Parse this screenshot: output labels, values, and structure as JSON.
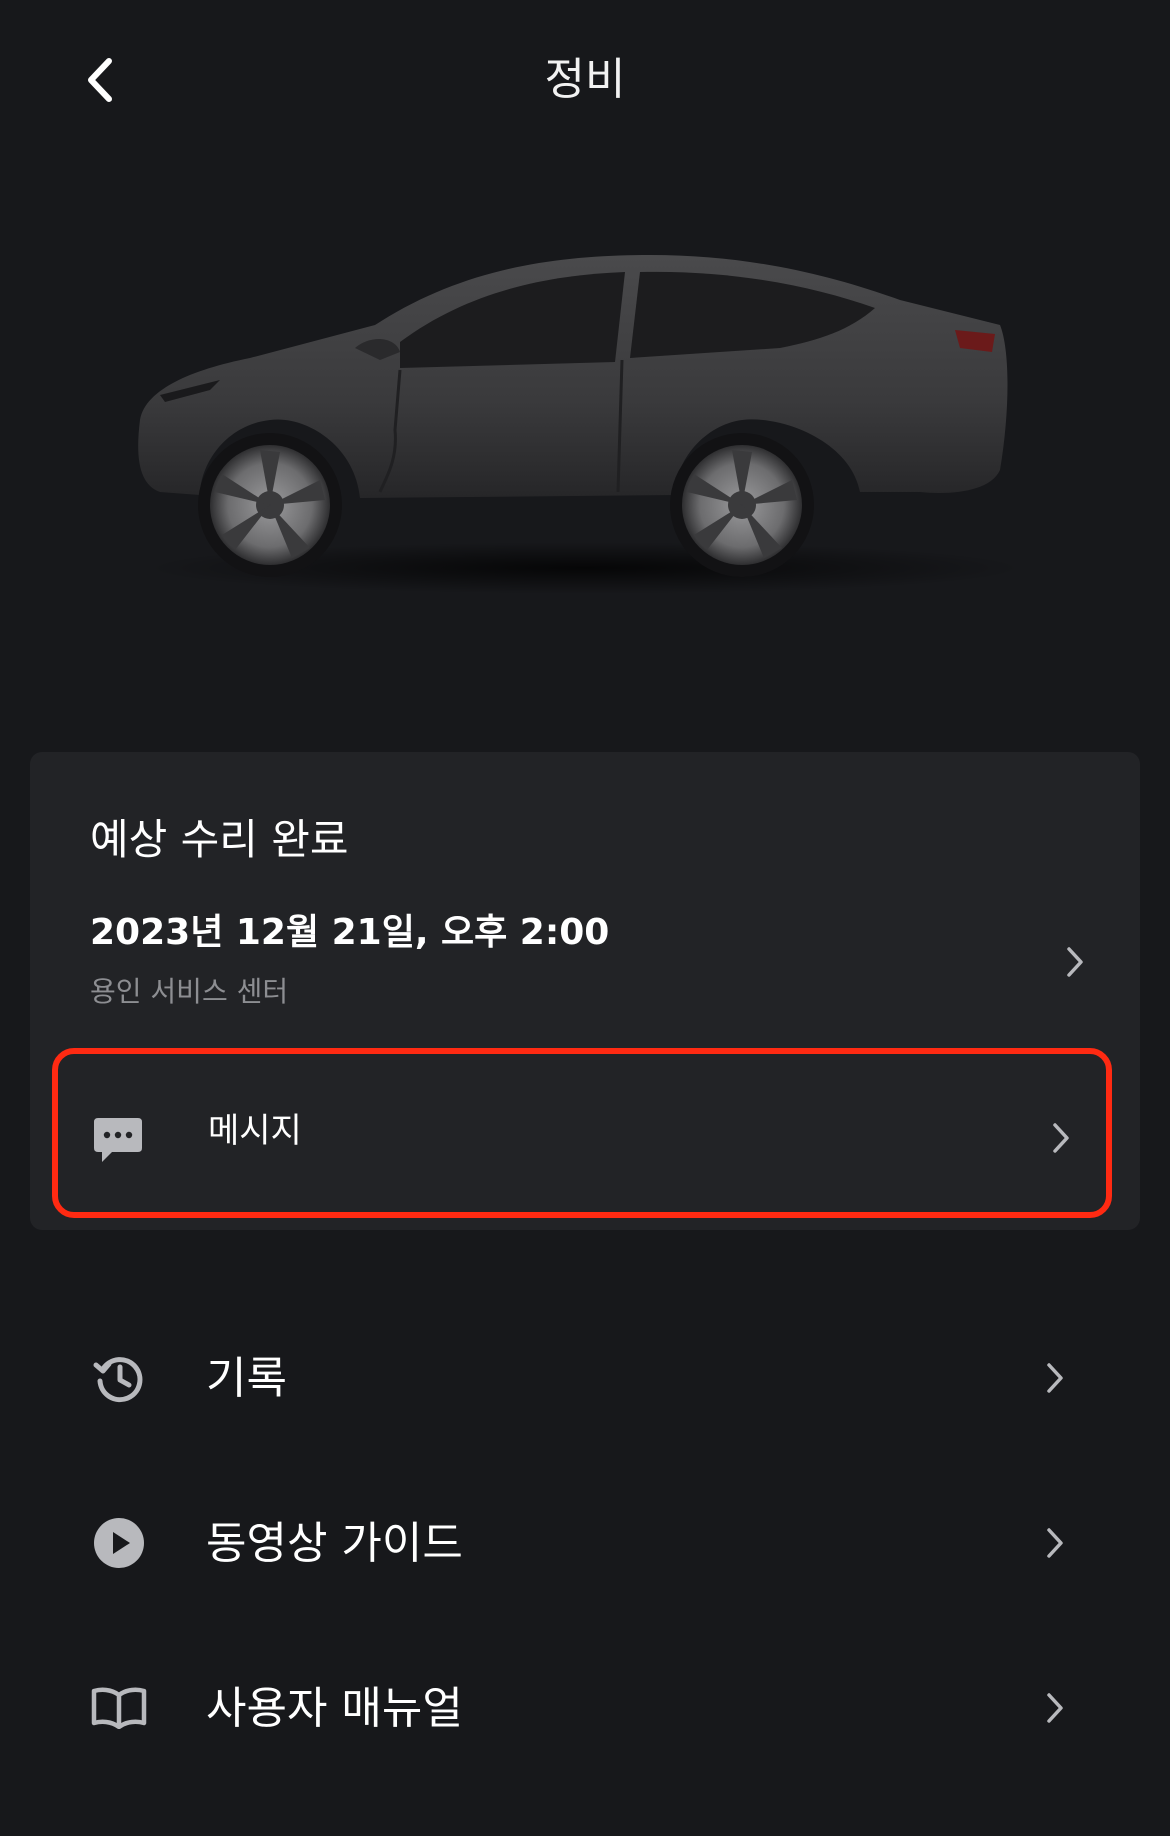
{
  "header": {
    "title": "정비",
    "back_icon": "chevron-left-icon"
  },
  "hero": {
    "image": "car-side-view"
  },
  "appointment": {
    "heading": "예상 수리 완료",
    "date": "2023년 12월 21일, 오후 2:00",
    "center": "용인 서비스 센터"
  },
  "message": {
    "label": "메시지",
    "icon": "chat-bubble-icon",
    "highlight_color": "#ff2a12"
  },
  "menu": [
    {
      "label": "기록",
      "icon": "history-icon"
    },
    {
      "label": "동영상 가이드",
      "icon": "play-circle-icon"
    },
    {
      "label": "사용자 매뉴얼",
      "icon": "book-icon"
    }
  ],
  "colors": {
    "background": "#17181b",
    "card": "#222326",
    "secondary_text": "#8d8e92",
    "icon": "#b8b9bd"
  }
}
